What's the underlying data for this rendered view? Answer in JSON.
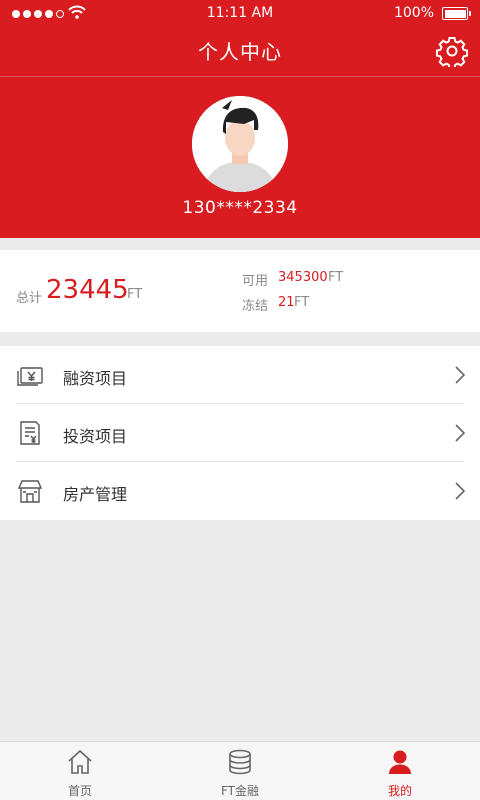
{
  "status_bar": {
    "time": "11:11 AM",
    "battery": "100%"
  },
  "header": {
    "title": "个人中心",
    "phone": "130****2334"
  },
  "balance": {
    "total_label": "总计",
    "total_value": "23445",
    "total_unit": "FT",
    "available_label": "可用",
    "available_value": "345300",
    "available_unit": "FT",
    "frozen_label": "冻结",
    "frozen_value": "21",
    "frozen_unit": "FT"
  },
  "menu": {
    "items": [
      {
        "label": "融资项目",
        "icon": "financing-icon"
      },
      {
        "label": "投资项目",
        "icon": "investment-icon"
      },
      {
        "label": "房产管理",
        "icon": "property-icon"
      }
    ]
  },
  "tabbar": {
    "tabs": [
      {
        "label": "首页",
        "icon": "home-icon"
      },
      {
        "label": "FT金融",
        "icon": "database-icon"
      },
      {
        "label": "我的",
        "icon": "user-icon"
      }
    ],
    "active": "我的"
  },
  "colors": {
    "accent": "#d81c1f",
    "background": "#ebebeb",
    "text": "#333333",
    "muted": "#8a8a8a"
  }
}
